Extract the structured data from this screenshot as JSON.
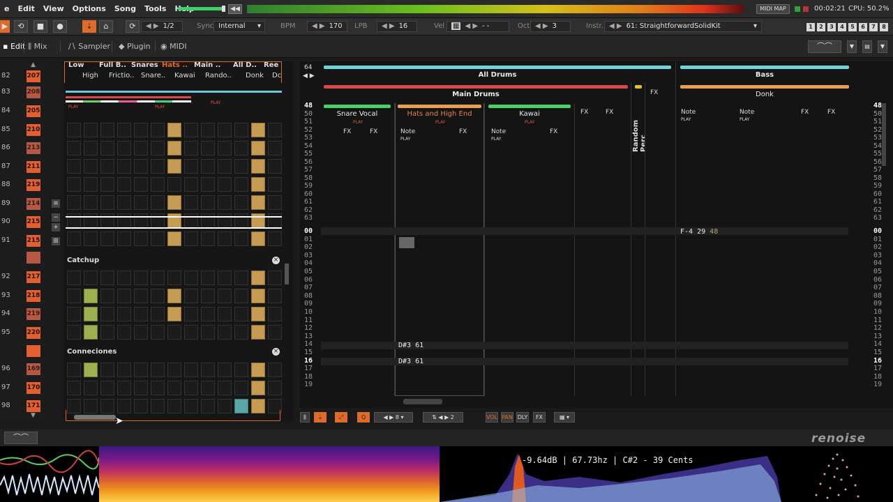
{
  "menubar": {
    "items": [
      "e",
      "Edit",
      "View",
      "Options",
      "Song",
      "Tools",
      "Help"
    ],
    "midi_map": "MIDI MAP",
    "time": "00:02:21",
    "cpu": "CPU: 50.2%"
  },
  "transport": {
    "sync_label": "Sync",
    "sync_value": "Internal",
    "bpm_label": "BPM",
    "bpm_value": "170",
    "lpb_label": "LPB",
    "lpb_value": "16",
    "vel_label": "Vel",
    "vel_value": "- -",
    "oct_label": "Oct",
    "oct_value": "3",
    "instr_label": "Instr.",
    "instr_value": "61: StraightforwardSolidKit",
    "pattern_step": "1/2",
    "numbers": [
      "1",
      "2",
      "3",
      "4",
      "5",
      "6",
      "7",
      "8"
    ]
  },
  "tabs": {
    "edit": "Edit",
    "mix": "Mix",
    "sampler": "Sampler",
    "plugin": "Plugin",
    "midi": "MIDI"
  },
  "sequence": {
    "rows": [
      {
        "num": "82",
        "pat": "207"
      },
      {
        "num": "83",
        "pat": "208"
      },
      {
        "num": "84",
        "pat": "205"
      },
      {
        "num": "85",
        "pat": "210"
      },
      {
        "num": "86",
        "pat": "213"
      },
      {
        "num": "87",
        "pat": "211"
      },
      {
        "num": "88",
        "pat": "219"
      },
      {
        "num": "89",
        "pat": "214"
      },
      {
        "num": "90",
        "pat": "215"
      },
      {
        "num": "91",
        "pat": "215"
      },
      {
        "num": "",
        "pat": ""
      },
      {
        "num": "92",
        "pat": "217"
      },
      {
        "num": "93",
        "pat": "218"
      },
      {
        "num": "94",
        "pat": "219"
      },
      {
        "num": "95",
        "pat": "220"
      },
      {
        "num": "",
        "pat": ""
      },
      {
        "num": "96",
        "pat": "169"
      },
      {
        "num": "97",
        "pat": "170"
      },
      {
        "num": "98",
        "pat": "171"
      }
    ]
  },
  "matrix": {
    "headers_top": [
      "Low",
      "Full B..",
      "Snares",
      "Hats ..",
      "Main ..",
      "All D..",
      "Ree"
    ],
    "headers_bottom": [
      "High",
      "Frictio..",
      "Snare..",
      "Kawai",
      "Rando..",
      "Donk",
      "Dc"
    ],
    "groups": [
      "Catchup",
      "Conneciones"
    ],
    "play": "PLAY"
  },
  "pattern": {
    "top_number": "64",
    "groups": {
      "all_drums": "All Drums",
      "bass": "Bass",
      "main_drums": "Main Drums"
    },
    "tracks": {
      "snare_vocal": "Snare Vocal",
      "hats": "Hats and High End",
      "kawai": "Kawai",
      "random_perc": "Random Perc",
      "donk": "Donk"
    },
    "col_labels": {
      "fx": "FX",
      "note": "Note",
      "play": "PLAY"
    },
    "rows_top": [
      "48",
      "50",
      "51",
      "52",
      "53",
      "54",
      "55",
      "56",
      "57",
      "58",
      "59",
      "60",
      "61",
      "62",
      "63"
    ],
    "rows_bottom": [
      "00",
      "01",
      "02",
      "03",
      "04",
      "05",
      "06",
      "07",
      "08",
      "09",
      "10",
      "11",
      "12",
      "13",
      "14",
      "15",
      "16",
      "17",
      "18",
      "19"
    ],
    "notes": {
      "bass_note": "F-4",
      "bass_inst": "29",
      "bass_vel": "48",
      "hats_note_1": "D#3 61",
      "hats_note_2": "D#3 61"
    }
  },
  "toolbar": {
    "step_value": "8",
    "edit_step": "2",
    "vol": "VOL",
    "pan": "PAN",
    "dly": "DLY",
    "fx": "FX"
  },
  "scopes": {
    "readout": "-9.64dB | 67.73hz | C#2 - 39 Cents"
  },
  "logo": "renoise"
}
